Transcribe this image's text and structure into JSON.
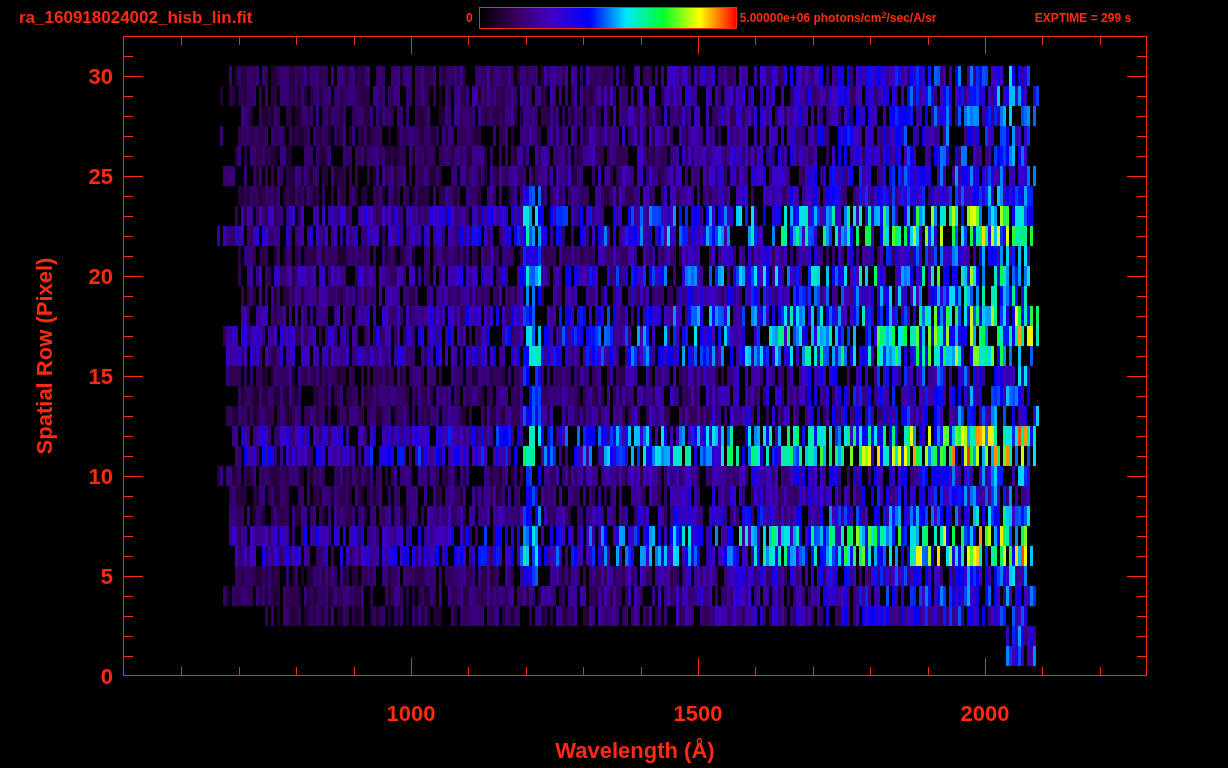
{
  "header": {
    "filename": "ra_160918024002_hisb_lin.fit",
    "colorbar_min": "0",
    "colorbar_max": "5.00000e+06 photons/cm$^{2}$/sec/A/sr",
    "exposure": "EXPTIME = 299 s"
  },
  "plot": {
    "xlabel": "Wavelength (Å)",
    "ylabel": "Spatial Row (Pixel)",
    "xticks": [
      "1000",
      "1500",
      "2000"
    ],
    "yticks": [
      "30",
      "25",
      "20",
      "15",
      "10",
      "5",
      "0"
    ]
  }
}
